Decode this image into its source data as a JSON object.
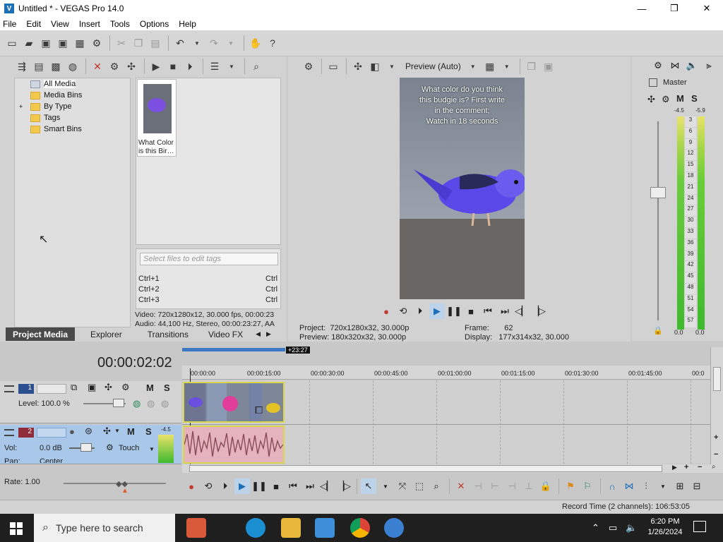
{
  "window": {
    "title": "Untitled * - VEGAS Pro 14.0",
    "minimize": "—",
    "maximize": "❐",
    "close": "✕"
  },
  "menu": [
    "File",
    "Edit",
    "View",
    "Insert",
    "Tools",
    "Options",
    "Help"
  ],
  "explorer": {
    "tree": [
      "All Media",
      "Media Bins",
      "By Type",
      "Tags",
      "Smart Bins"
    ],
    "thumb_label": "What Color is this Bir…",
    "tag_placeholder": "Select files to edit tags",
    "shortcuts": [
      {
        "k": "Ctrl+1",
        "v": "Ctrl"
      },
      {
        "k": "Ctrl+2",
        "v": "Ctrl"
      },
      {
        "k": "Ctrl+3",
        "v": "Ctrl"
      }
    ],
    "video_info": "Video: 720x1280x12, 30.000 fps, 00:00:23",
    "audio_info": "Audio: 44,100 Hz, Stereo, 00:00:23:27, AA",
    "tabs": [
      "Project Media",
      "Explorer",
      "Transitions",
      "Video FX"
    ]
  },
  "preview": {
    "mode": "Preview (Auto)",
    "overlay_lines": [
      "What color do you think",
      "this budgie is? First write",
      "in the comment;",
      "Watch in 18 seconds"
    ],
    "project_label": "Project:",
    "project_value": "720x1280x32, 30.000p",
    "preview_label": "Preview:",
    "preview_value": "180x320x32, 30.000p",
    "frame_label": "Frame:",
    "frame_value": "62",
    "display_label": "Display:",
    "display_value": "177x314x32, 30.000"
  },
  "mixer": {
    "master": "Master",
    "m": "M",
    "s": "S",
    "peak_l": "-4.5",
    "peak_r": "-5.9",
    "scale": [
      "3",
      "6",
      "9",
      "12",
      "15",
      "18",
      "21",
      "24",
      "27",
      "30",
      "33",
      "36",
      "39",
      "42",
      "45",
      "48",
      "51",
      "54",
      "57"
    ],
    "bottom_l": "0.0",
    "bottom_r": "0.0"
  },
  "timeline": {
    "timecode": "00:00:02:02",
    "region_end": "+23:27",
    "ruler": [
      "00:00:00",
      "00:00:15:00",
      "00:00:30:00",
      "00:00:45:00",
      "00:01:00:00",
      "00:01:15:00",
      "00:01:30:00",
      "00:01:45:00",
      "00:0"
    ],
    "track1": {
      "num": "1",
      "level": "Level: 100.0 %",
      "m": "M",
      "s": "S"
    },
    "track2": {
      "num": "2",
      "vol_label": "Vol:",
      "vol": "0.0 dB",
      "touch": "Touch",
      "pan": "Pan:",
      "pan_val": "Center",
      "m": "M",
      "s": "S",
      "peak": "-4.5"
    },
    "rate": "Rate: 1.00",
    "record_time": "Record Time (2 channels): 106:53:05"
  },
  "taskbar": {
    "search": "Type here to search",
    "time": "6:20 PM",
    "date": "1/26/2024"
  }
}
